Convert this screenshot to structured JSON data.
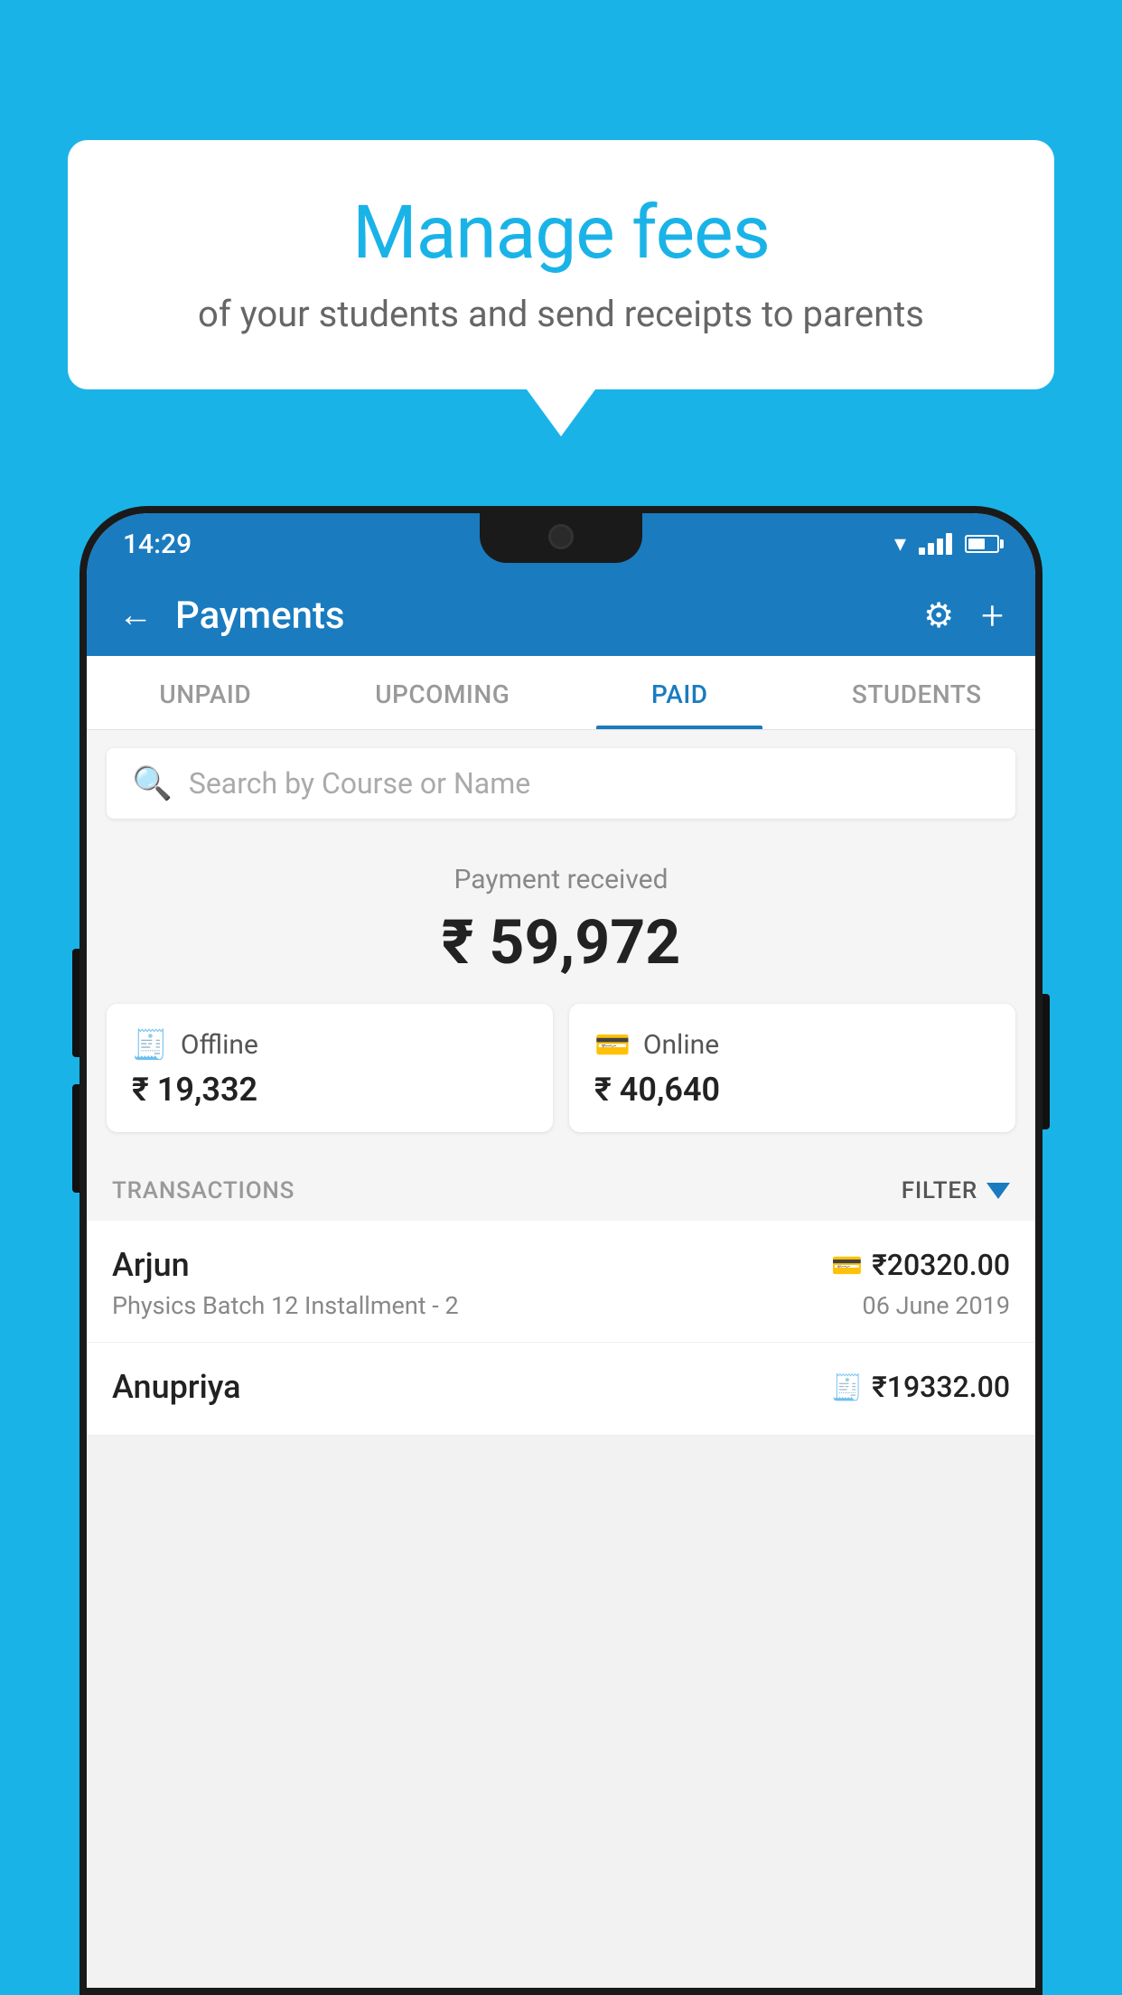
{
  "background": {
    "color": "#1ab3e8"
  },
  "speech_bubble": {
    "title": "Manage fees",
    "subtitle": "of your students and send receipts to parents"
  },
  "status_bar": {
    "time": "14:29"
  },
  "app_header": {
    "title": "Payments",
    "back_label": "←",
    "gear_label": "⚙",
    "plus_label": "+"
  },
  "tabs": [
    {
      "label": "UNPAID",
      "active": false
    },
    {
      "label": "UPCOMING",
      "active": false
    },
    {
      "label": "PAID",
      "active": true
    },
    {
      "label": "STUDENTS",
      "active": false
    }
  ],
  "search": {
    "placeholder": "Search by Course or Name"
  },
  "payment_summary": {
    "label": "Payment received",
    "amount": "₹ 59,972",
    "offline_label": "Offline",
    "offline_amount": "₹ 19,332",
    "online_label": "Online",
    "online_amount": "₹ 40,640"
  },
  "transactions": {
    "header": "TRANSACTIONS",
    "filter": "FILTER",
    "rows": [
      {
        "name": "Arjun",
        "amount": "₹20320.00",
        "course": "Physics Batch 12 Installment - 2",
        "date": "06 June 2019",
        "payment_type": "online"
      },
      {
        "name": "Anupriya",
        "amount": "₹19332.00",
        "course": "",
        "date": "",
        "payment_type": "offline"
      }
    ]
  }
}
